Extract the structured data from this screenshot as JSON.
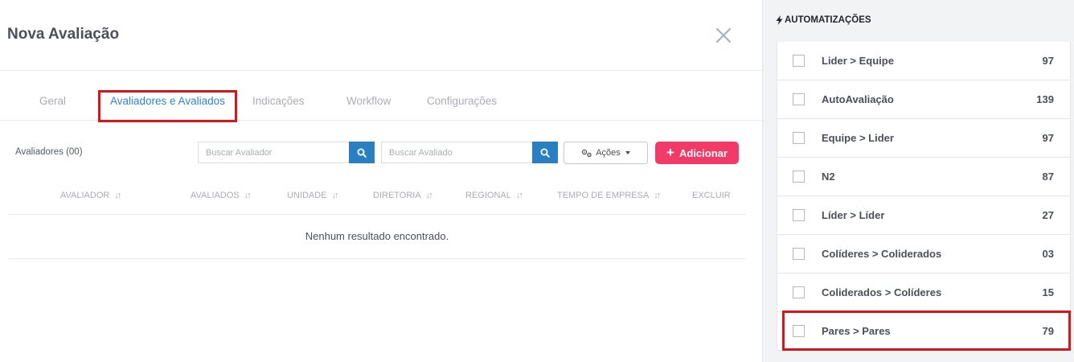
{
  "modal": {
    "title": "Nova Avaliação",
    "tabs": [
      {
        "label": "Geral",
        "active": false
      },
      {
        "label": "Avaliadores e Avaliados",
        "active": true
      },
      {
        "label": "Indicações",
        "active": false
      },
      {
        "label": "Workflow",
        "active": false
      },
      {
        "label": "Configurações",
        "active": false
      }
    ],
    "toolbar": {
      "avaliadores_label": "Avaliadores (00)",
      "search_avaliador_placeholder": "Buscar Avaliador",
      "search_avaliado_placeholder": "Buscar Avaliado",
      "acoes_label": "Ações",
      "adicionar_label": "Adicionar"
    },
    "table": {
      "columns": [
        "AVALIADOR",
        "AVALIADOS",
        "UNIDADE",
        "DIRETORIA",
        "REGIONAL",
        "TEMPO DE EMPRESA",
        "EXCLUIR"
      ],
      "empty_message": "Nenhum resultado encontrado."
    }
  },
  "automations": {
    "title": "AUTOMATIZAÇÕES",
    "items": [
      {
        "label": "Lider > Equipe",
        "count": "97"
      },
      {
        "label": "AutoAvaliação",
        "count": "139"
      },
      {
        "label": "Equipe > Lider",
        "count": "97"
      },
      {
        "label": "N2",
        "count": "87"
      },
      {
        "label": "Líder > Líder",
        "count": "27"
      },
      {
        "label": "Colíderes > Coliderados",
        "count": "03"
      },
      {
        "label": "Coliderados > Colíderes",
        "count": "15"
      },
      {
        "label": "Pares > Pares",
        "count": "79"
      }
    ]
  },
  "colors": {
    "accent_blue": "#2a7fc3",
    "add_button": "#f23a68",
    "highlight": "#d9151c"
  },
  "icons": {
    "close": "close-icon",
    "search": "search-icon",
    "gears": "gears-icon",
    "bolt": "bolt-icon",
    "sort": "sort-icon"
  }
}
